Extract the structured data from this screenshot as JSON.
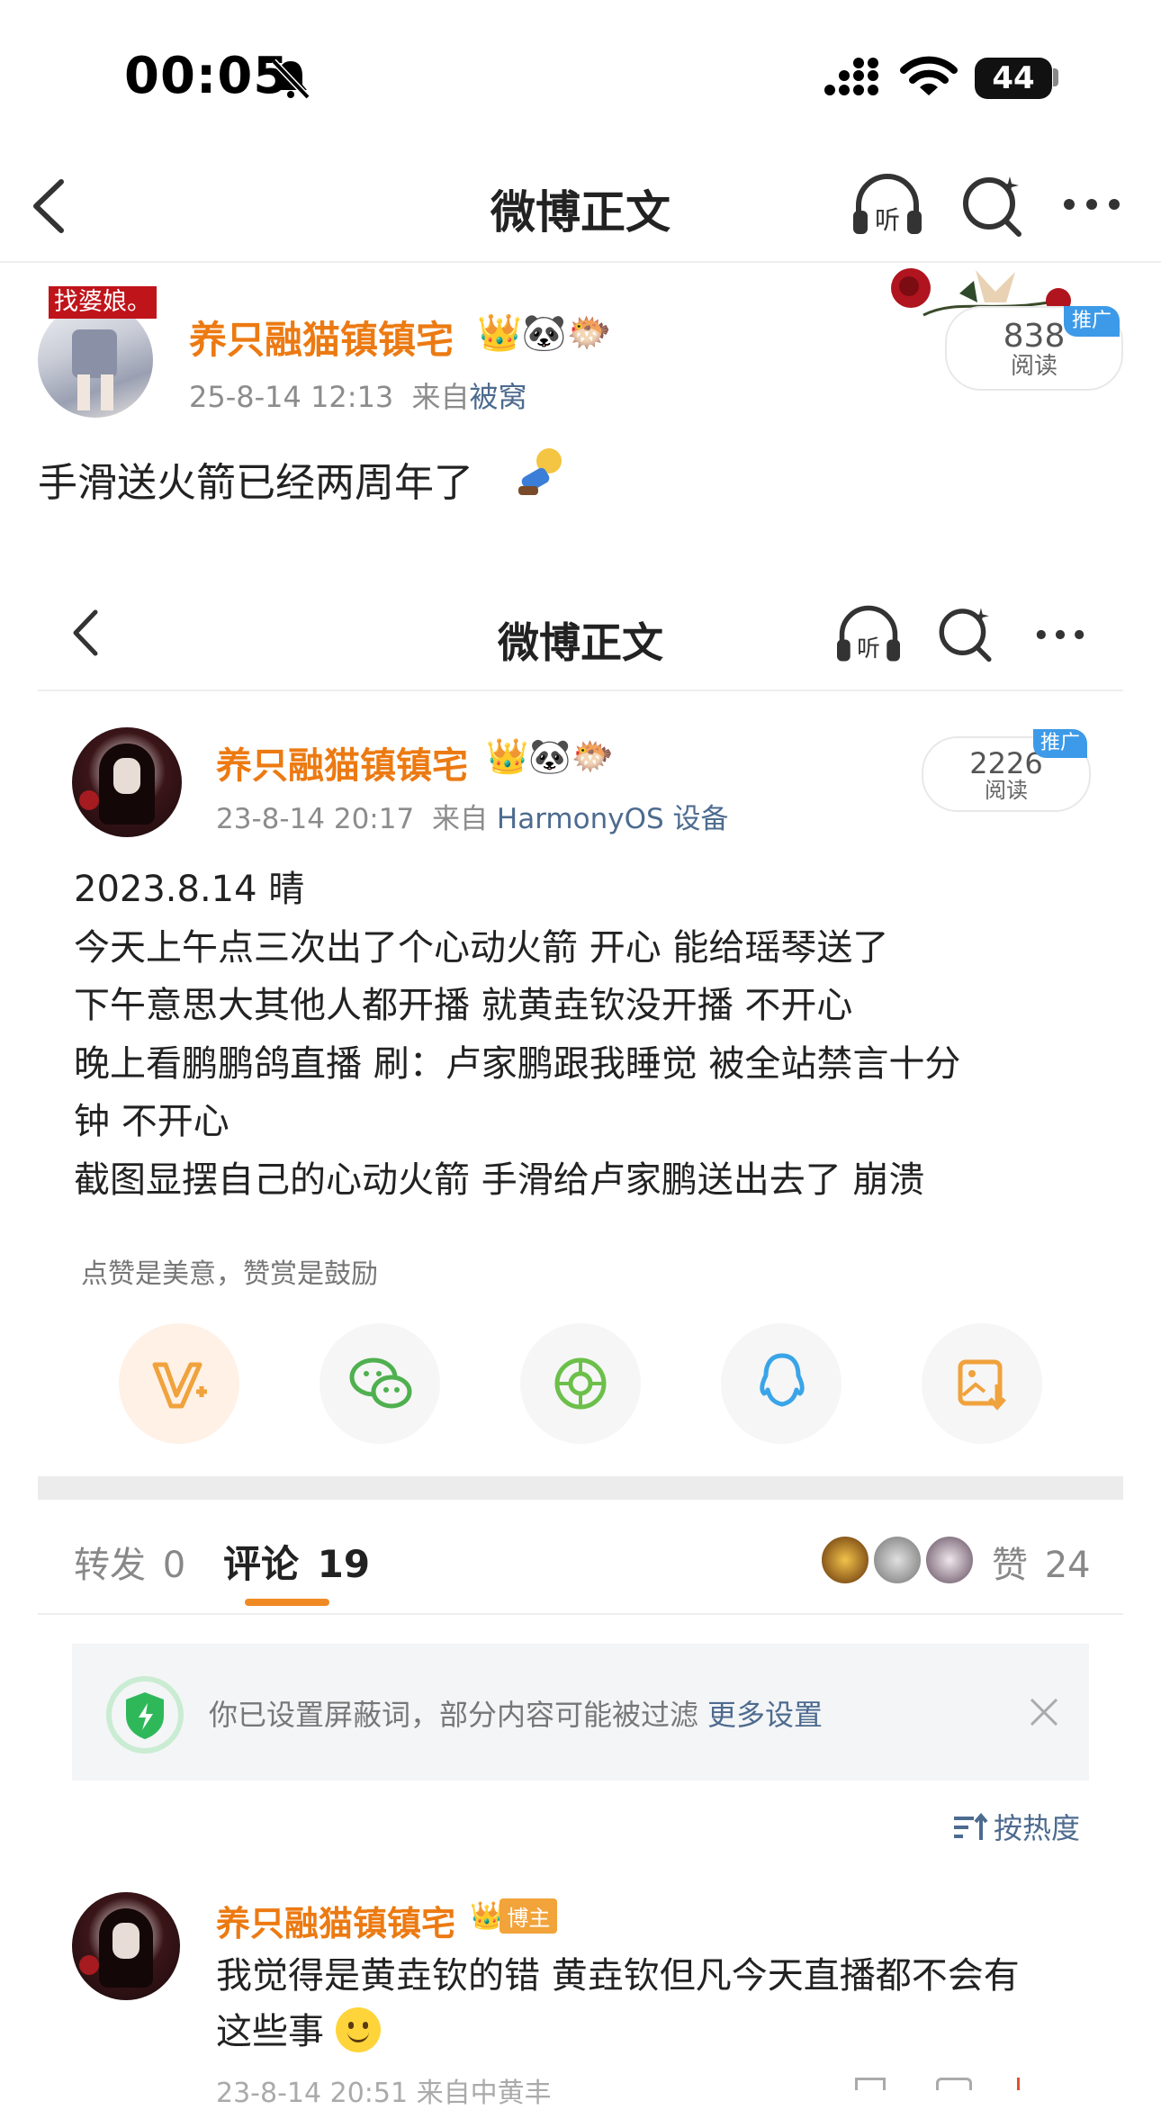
{
  "status_bar": {
    "time": "00:05",
    "battery": "44"
  },
  "outer": {
    "nav": {
      "title": "微博正文"
    },
    "post": {
      "avatar_tag": "找婆娘。",
      "username": "养只融猫镇镇宅",
      "time": "25-8-14 12:13",
      "source_prefix": "来自",
      "source": "被窝",
      "reads_count": "838",
      "reads_label": "阅读",
      "promo": "推广",
      "text": "手滑送火箭已经两周年了"
    }
  },
  "inner": {
    "nav": {
      "title": "微博正文"
    },
    "post": {
      "username": "养只融猫镇镇宅",
      "time": "23-8-14 20:17",
      "source_prefix": "来自",
      "source": "HarmonyOS 设备",
      "reads_count": "2226",
      "reads_label": "阅读",
      "promo": "推广",
      "lines": [
        "2023.8.14 晴",
        "今天上午点三次出了个心动火箭 开心 能给瑶琴送了",
        "下午意思大其他人都开播 就黄垚钦没开播 不开心",
        "晚上看鹏鹏鸽直播 刷：卢家鹏跟我睡觉 被全站禁言十分",
        "钟 不开心",
        "截图显摆自己的心动火箭 手滑给卢家鹏送出去了 崩溃"
      ]
    },
    "reward_hint": "点赞是美意，赞赏是鼓励",
    "share_icons": [
      "reward-icon",
      "wechat-icon",
      "moments-icon",
      "qq-icon",
      "save-image-icon"
    ],
    "tabs": {
      "repost_label": "转发",
      "repost_count": "0",
      "comment_label": "评论",
      "comment_count": "19",
      "like_label": "赞",
      "like_count": "24"
    },
    "filter_notice": {
      "text": "你已设置屏蔽词，部分内容可能被过滤",
      "link": "更多设置"
    },
    "sort_label": "按热度",
    "comment": {
      "username": "养只融猫镇镇宅",
      "badge": "博主",
      "line1": "我觉得是黄垚钦的错 黄垚钦但凡今天直播都不会有",
      "line2": "这些事",
      "meta_partial": "23-8-14 20:51 来自中黄丰"
    }
  },
  "colors": {
    "accent": "#ec7a12",
    "link": "#4d6b8f",
    "promo": "#3d9ae8"
  }
}
